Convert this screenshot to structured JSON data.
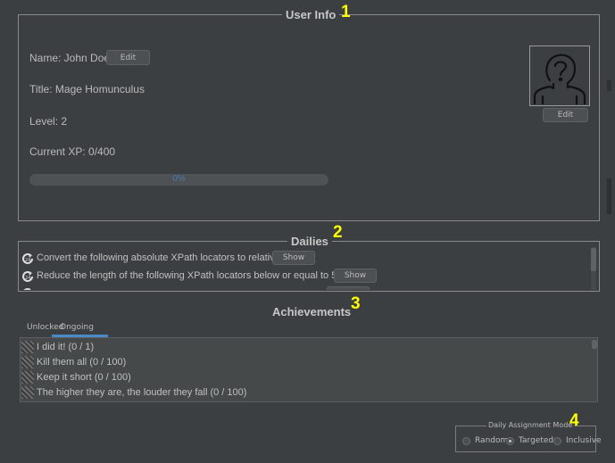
{
  "user_info": {
    "title": "User Info",
    "marker": "1",
    "name": "Name: John Doe",
    "name_edit": "Edit",
    "title_line": "Title: Mage Homunculus",
    "level": "Level: 2",
    "xp": "Current XP: 0/400",
    "progress_text": "0%",
    "progress_value": 0,
    "avatar_edit": "Edit"
  },
  "dailies": {
    "title": "Dailies",
    "marker": "2",
    "items": [
      {
        "text": "Convert the following absolute XPath locators to relative",
        "button": "Show"
      },
      {
        "text": "Reduce the length of the following XPath locators below or equal to 50",
        "button": "Show"
      }
    ]
  },
  "achievements": {
    "title": "Achievements",
    "marker": "3",
    "tabs": [
      "Unlocked",
      "Ongoing"
    ],
    "active_tab": "Ongoing",
    "items": [
      "I did it! (0 / 1)",
      "Kill them all (0 / 100)",
      "Keep it short (0 / 100)",
      "The higher they are, the louder they fall (0 / 100)"
    ]
  },
  "assignment_mode": {
    "title": "Daily Assignment Mode",
    "marker": "4",
    "options": [
      "Random",
      "Targeted",
      "Inclusive"
    ],
    "selected": "Targeted"
  },
  "colors": {
    "background": "#3c3f41",
    "accent": "#4a88c7",
    "marker": "#ffff00"
  }
}
